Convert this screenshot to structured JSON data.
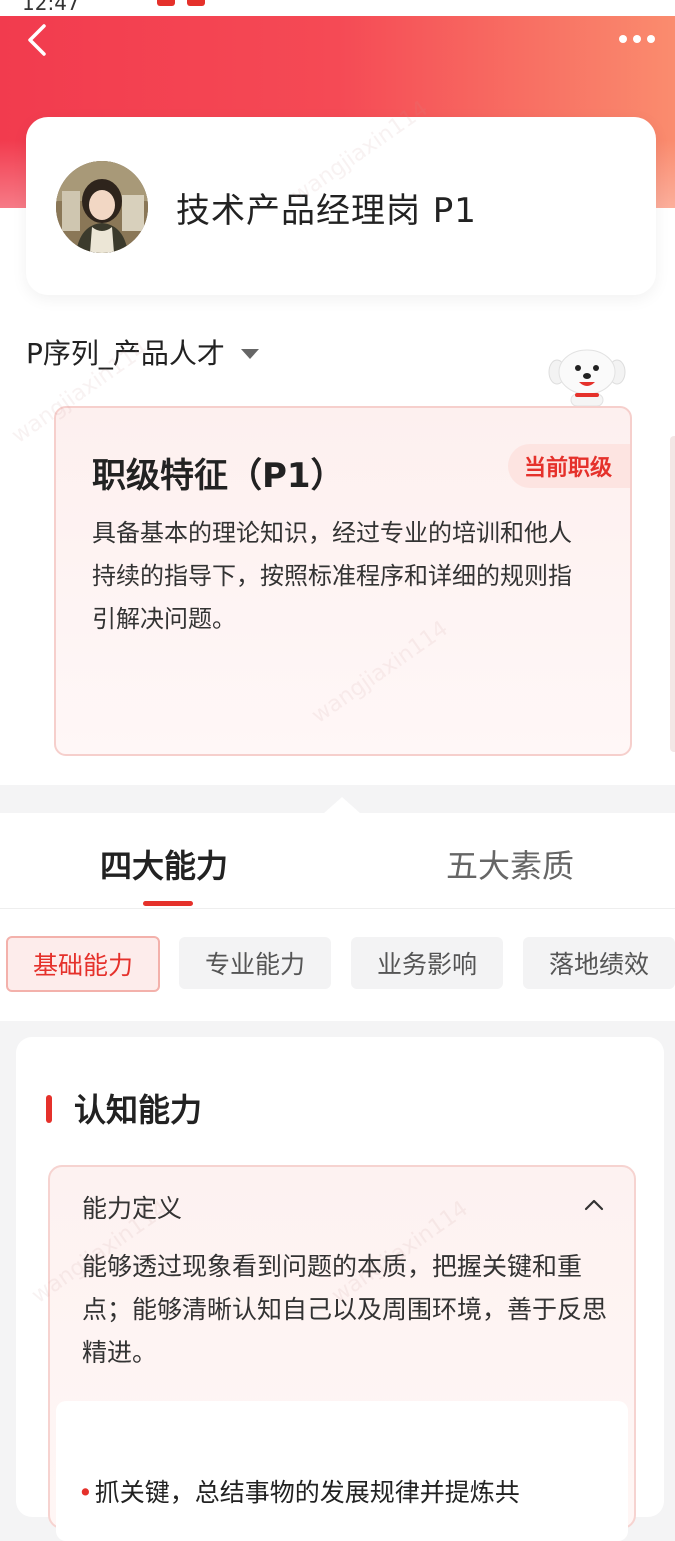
{
  "status_bar": {
    "time": "12:47"
  },
  "header": {
    "back_icon": "chevron-left-icon",
    "more_icon": "more-dots-icon"
  },
  "profile": {
    "title": "技术产品经理岗 P1"
  },
  "sequence": {
    "label": "P序列_产品人才"
  },
  "level_card": {
    "title": "职级特征（P1）",
    "badge": "当前职级",
    "description": "具备基本的理论知识，经过专业的培训和他人持续的指导下，按照标准程序和详细的规则指引解决问题。"
  },
  "tabs": [
    {
      "label": "四大能力",
      "active": true
    },
    {
      "label": "五大素质",
      "active": false
    }
  ],
  "chips": [
    {
      "label": "基础能力",
      "active": true
    },
    {
      "label": "专业能力",
      "active": false
    },
    {
      "label": "业务影响",
      "active": false
    },
    {
      "label": "落地绩效",
      "active": false
    }
  ],
  "section": {
    "title": "认知能力",
    "definition_label": "能力定义",
    "definition_text": "能够透过现象看到问题的本质，把握关键和重点；能够清晰认知自己以及周围环境，善于反思精进。",
    "bullet": "抓关键，总结事物的发展规律并提炼共"
  },
  "colors": {
    "accent": "#e5312b",
    "header_start": "#f23b4e",
    "header_end": "#fa8c6e"
  },
  "watermark": "wangjiaxin114"
}
